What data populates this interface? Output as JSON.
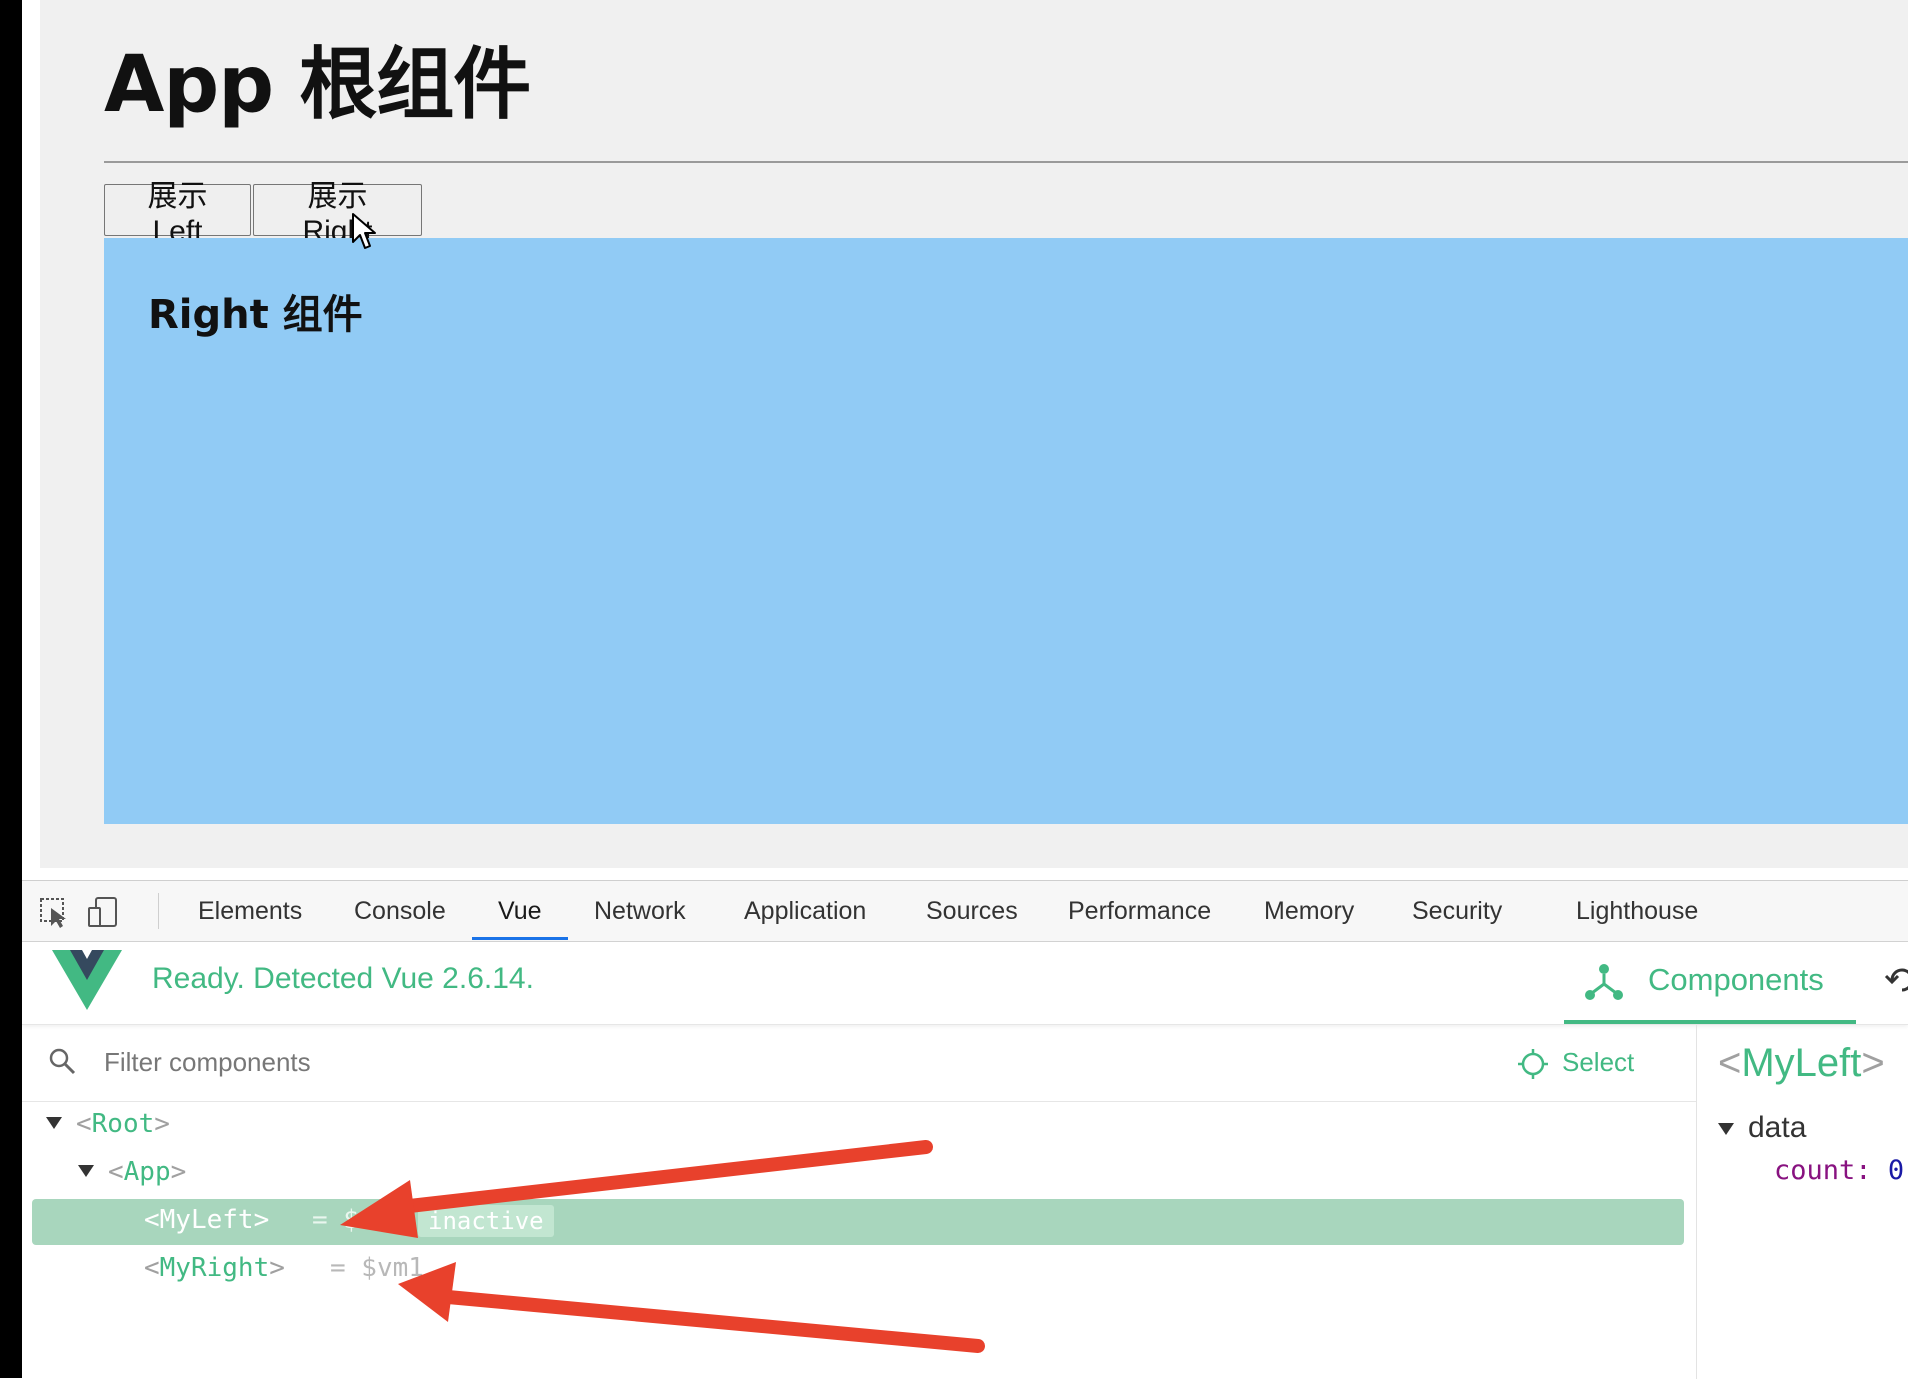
{
  "page": {
    "title": "App 根组件",
    "buttons": {
      "show_left": "展示 Left",
      "show_right": "展示 Right"
    },
    "right_component_title": "Right 组件"
  },
  "devtools": {
    "tabs": [
      "Elements",
      "Console",
      "Vue",
      "Network",
      "Application",
      "Sources",
      "Performance",
      "Memory",
      "Security",
      "Lighthouse"
    ],
    "active_tab": "Vue",
    "vue": {
      "status": "Ready. Detected Vue 2.6.14.",
      "components_tab": "Components",
      "filter_placeholder": "Filter components",
      "select_label": "Select",
      "tree": {
        "root": "Root",
        "app": "App",
        "my_left": {
          "name": "MyLeft",
          "ref": "= $vm0",
          "badge": "inactive"
        },
        "my_right": {
          "name": "MyRight",
          "ref": "= $vm1"
        }
      },
      "inspector": {
        "component": "MyLeft",
        "section": "data",
        "prop_key": "count:",
        "prop_value": "0"
      }
    }
  },
  "colors": {
    "vue_green": "#42b983",
    "component_bg": "#91cbf5",
    "selected_row": "#a8d6bd",
    "annotation_red": "#e8412c"
  }
}
